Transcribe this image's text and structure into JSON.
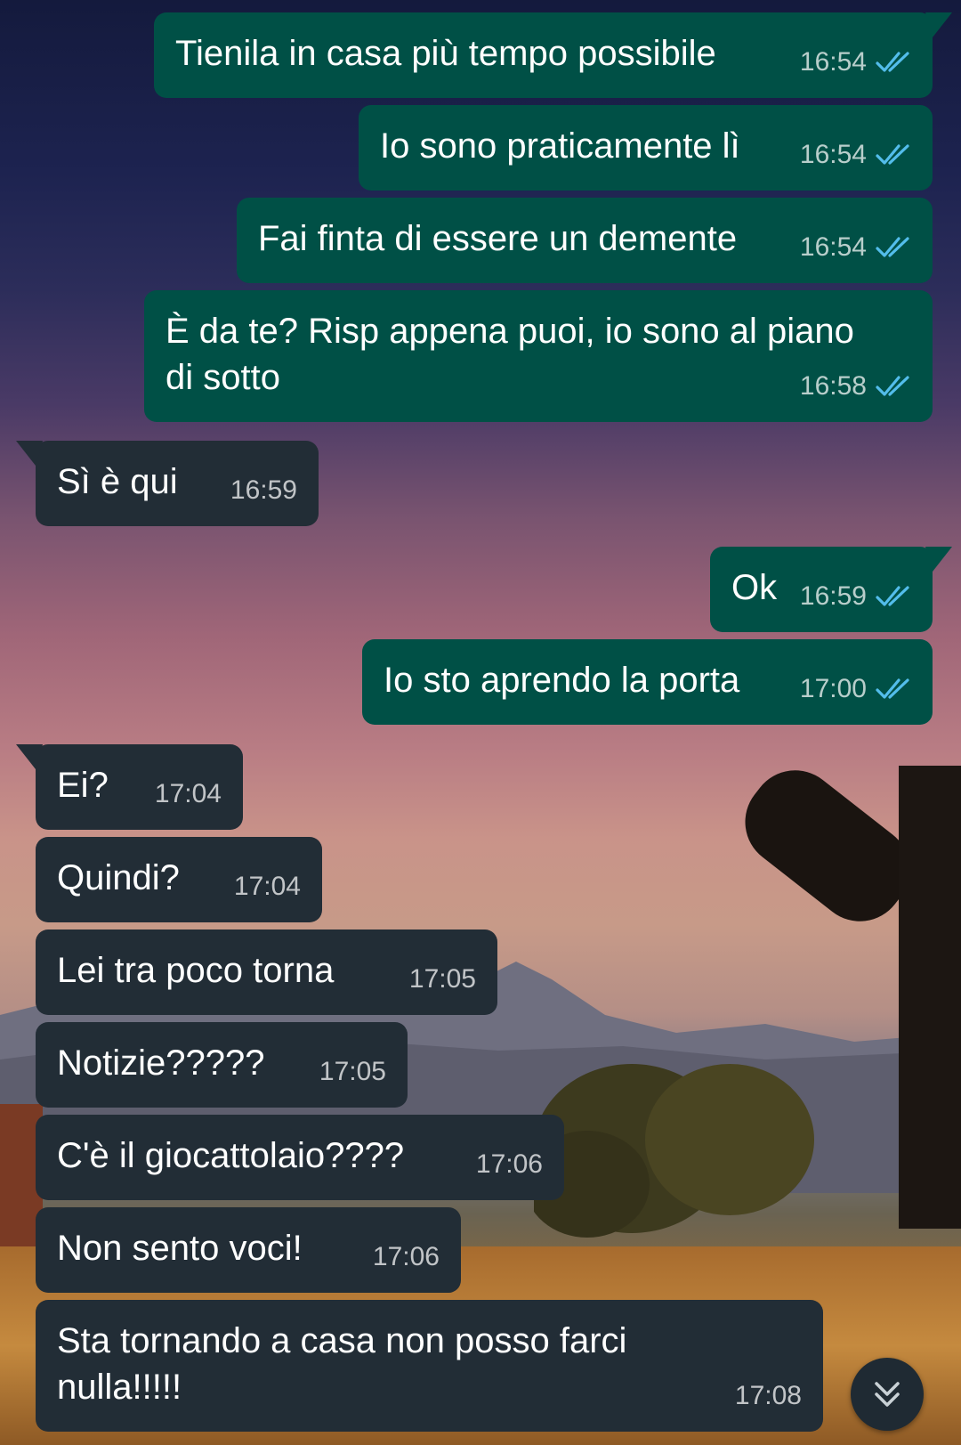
{
  "colors": {
    "outgoing_bubble": "#005046",
    "incoming_bubble": "#222d36",
    "read_tick": "#53bdeb"
  },
  "messages": [
    {
      "dir": "out",
      "text": "Tienila in casa più tempo possibile",
      "time": "16:54",
      "status": "read"
    },
    {
      "dir": "out",
      "text": "Io sono praticamente lì",
      "time": "16:54",
      "status": "read"
    },
    {
      "dir": "out",
      "text": "Fai finta di essere un demente",
      "time": "16:54",
      "status": "read"
    },
    {
      "dir": "out",
      "text_line1": "È da te? Risp appena puoi, io sono al piano",
      "text_line2": "di sotto",
      "time": "16:58",
      "status": "read"
    },
    {
      "dir": "in",
      "text": "Sì è qui",
      "time": "16:59"
    },
    {
      "dir": "out",
      "text": "Ok",
      "time": "16:59",
      "status": "read"
    },
    {
      "dir": "out",
      "text": "Io sto aprendo la porta",
      "time": "17:00",
      "status": "read"
    },
    {
      "dir": "in",
      "text": "Ei?",
      "time": "17:04"
    },
    {
      "dir": "in",
      "text": "Quindi?",
      "time": "17:04"
    },
    {
      "dir": "in",
      "text": "Lei tra poco torna",
      "time": "17:05"
    },
    {
      "dir": "in",
      "text": "Notizie?????",
      "time": "17:05"
    },
    {
      "dir": "in",
      "text": "C'è il giocattolaio????",
      "time": "17:06"
    },
    {
      "dir": "in",
      "text": "Non sento voci!",
      "time": "17:06"
    },
    {
      "dir": "in",
      "text_line1": "Sta tornando a casa non posso farci",
      "text_line2": "nulla!!!!!",
      "time": "17:08"
    }
  ],
  "icons": {
    "read_receipt": "double-check-icon",
    "scroll_down": "chevron-double-down-icon"
  }
}
